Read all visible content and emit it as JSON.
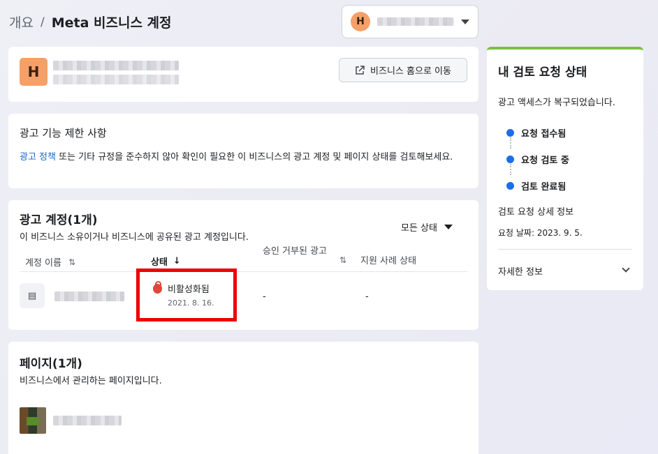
{
  "breadcrumb": {
    "parent": "개요",
    "separator": "/",
    "current": "Meta 비즈니스 계정"
  },
  "account_switcher": {
    "avatar_letter": "H"
  },
  "business": {
    "avatar_letter": "H",
    "home_button_label": "비즈니스 홈으로 이동"
  },
  "restriction": {
    "title": "광고 기능 제한 사항",
    "link_text": "광고 정책",
    "description": " 또는 기타 규정을 준수하지 않아 확인이 필요한 이 비즈니스의 광고 계정 및 페이지 상태를 검토해보세요."
  },
  "ad_accounts": {
    "title": "광고 계정(1개)",
    "subtitle": "이 비즈니스 소유이거나 비즈니스에 공유된 광고 계정입니다.",
    "filter_label": "모든 상태",
    "columns": {
      "name": "계정 이름",
      "name_sort": "⇅",
      "status": "상태",
      "status_sort": "↓",
      "denied": "승인 거부된 광고",
      "denied_sort": "⇅",
      "support": "지원 사례 상태"
    },
    "row": {
      "icon": "▤",
      "status": "비활성화됨",
      "status_date": "2021. 8. 16.",
      "denied": "-",
      "support": "-"
    }
  },
  "pages": {
    "title": "페이지(1개)",
    "subtitle": "비즈니스에서 관리하는 페이지입니다."
  },
  "review": {
    "title": "내 검토 요청 상태",
    "description": "광고 액세스가 복구되었습니다.",
    "steps": [
      "요청 접수됨",
      "요청 검토 중",
      "검토 완료됨"
    ],
    "detail_title": "검토 요청 상세 정보",
    "request_date": "요청 날짜: 2023. 9. 5.",
    "more_info": "자세한 정보"
  },
  "colors": {
    "accent_blue": "#1a6ee8",
    "link_blue": "#1a63c8",
    "alert_red": "#e0473b",
    "highlight_red": "#ee0000",
    "review_green": "#7ac143"
  }
}
